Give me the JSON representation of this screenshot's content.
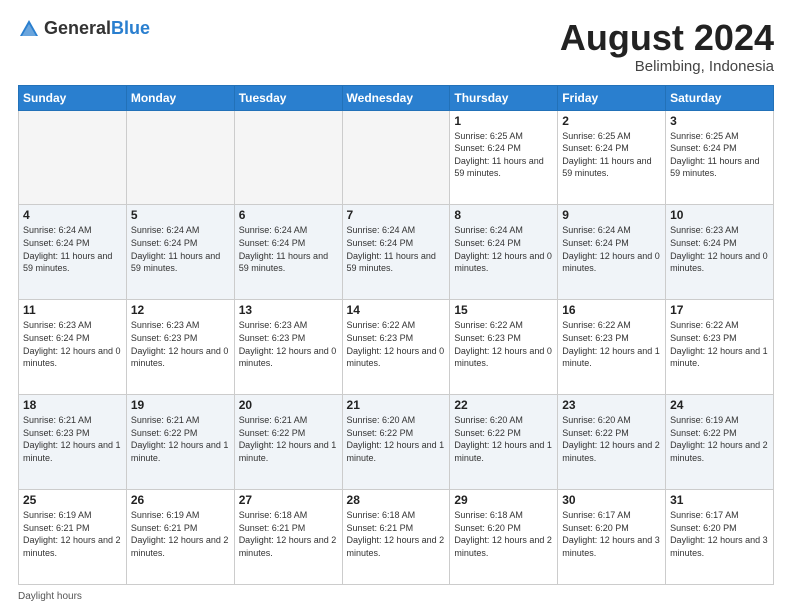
{
  "header": {
    "logo_general": "General",
    "logo_blue": "Blue",
    "title": "August 2024",
    "location": "Belimbing, Indonesia"
  },
  "days_of_week": [
    "Sunday",
    "Monday",
    "Tuesday",
    "Wednesday",
    "Thursday",
    "Friday",
    "Saturday"
  ],
  "footer": {
    "daylight_label": "Daylight hours"
  },
  "weeks": [
    [
      {
        "day": "",
        "empty": true
      },
      {
        "day": "",
        "empty": true
      },
      {
        "day": "",
        "empty": true
      },
      {
        "day": "",
        "empty": true
      },
      {
        "day": "1",
        "sunrise": "6:25 AM",
        "sunset": "6:24 PM",
        "daylight": "11 hours and 59 minutes."
      },
      {
        "day": "2",
        "sunrise": "6:25 AM",
        "sunset": "6:24 PM",
        "daylight": "11 hours and 59 minutes."
      },
      {
        "day": "3",
        "sunrise": "6:25 AM",
        "sunset": "6:24 PM",
        "daylight": "11 hours and 59 minutes."
      }
    ],
    [
      {
        "day": "4",
        "sunrise": "6:24 AM",
        "sunset": "6:24 PM",
        "daylight": "11 hours and 59 minutes."
      },
      {
        "day": "5",
        "sunrise": "6:24 AM",
        "sunset": "6:24 PM",
        "daylight": "11 hours and 59 minutes."
      },
      {
        "day": "6",
        "sunrise": "6:24 AM",
        "sunset": "6:24 PM",
        "daylight": "11 hours and 59 minutes."
      },
      {
        "day": "7",
        "sunrise": "6:24 AM",
        "sunset": "6:24 PM",
        "daylight": "11 hours and 59 minutes."
      },
      {
        "day": "8",
        "sunrise": "6:24 AM",
        "sunset": "6:24 PM",
        "daylight": "12 hours and 0 minutes."
      },
      {
        "day": "9",
        "sunrise": "6:24 AM",
        "sunset": "6:24 PM",
        "daylight": "12 hours and 0 minutes."
      },
      {
        "day": "10",
        "sunrise": "6:23 AM",
        "sunset": "6:24 PM",
        "daylight": "12 hours and 0 minutes."
      }
    ],
    [
      {
        "day": "11",
        "sunrise": "6:23 AM",
        "sunset": "6:24 PM",
        "daylight": "12 hours and 0 minutes."
      },
      {
        "day": "12",
        "sunrise": "6:23 AM",
        "sunset": "6:23 PM",
        "daylight": "12 hours and 0 minutes."
      },
      {
        "day": "13",
        "sunrise": "6:23 AM",
        "sunset": "6:23 PM",
        "daylight": "12 hours and 0 minutes."
      },
      {
        "day": "14",
        "sunrise": "6:22 AM",
        "sunset": "6:23 PM",
        "daylight": "12 hours and 0 minutes."
      },
      {
        "day": "15",
        "sunrise": "6:22 AM",
        "sunset": "6:23 PM",
        "daylight": "12 hours and 0 minutes."
      },
      {
        "day": "16",
        "sunrise": "6:22 AM",
        "sunset": "6:23 PM",
        "daylight": "12 hours and 1 minute."
      },
      {
        "day": "17",
        "sunrise": "6:22 AM",
        "sunset": "6:23 PM",
        "daylight": "12 hours and 1 minute."
      }
    ],
    [
      {
        "day": "18",
        "sunrise": "6:21 AM",
        "sunset": "6:23 PM",
        "daylight": "12 hours and 1 minute."
      },
      {
        "day": "19",
        "sunrise": "6:21 AM",
        "sunset": "6:22 PM",
        "daylight": "12 hours and 1 minute."
      },
      {
        "day": "20",
        "sunrise": "6:21 AM",
        "sunset": "6:22 PM",
        "daylight": "12 hours and 1 minute."
      },
      {
        "day": "21",
        "sunrise": "6:20 AM",
        "sunset": "6:22 PM",
        "daylight": "12 hours and 1 minute."
      },
      {
        "day": "22",
        "sunrise": "6:20 AM",
        "sunset": "6:22 PM",
        "daylight": "12 hours and 1 minute."
      },
      {
        "day": "23",
        "sunrise": "6:20 AM",
        "sunset": "6:22 PM",
        "daylight": "12 hours and 2 minutes."
      },
      {
        "day": "24",
        "sunrise": "6:19 AM",
        "sunset": "6:22 PM",
        "daylight": "12 hours and 2 minutes."
      }
    ],
    [
      {
        "day": "25",
        "sunrise": "6:19 AM",
        "sunset": "6:21 PM",
        "daylight": "12 hours and 2 minutes."
      },
      {
        "day": "26",
        "sunrise": "6:19 AM",
        "sunset": "6:21 PM",
        "daylight": "12 hours and 2 minutes."
      },
      {
        "day": "27",
        "sunrise": "6:18 AM",
        "sunset": "6:21 PM",
        "daylight": "12 hours and 2 minutes."
      },
      {
        "day": "28",
        "sunrise": "6:18 AM",
        "sunset": "6:21 PM",
        "daylight": "12 hours and 2 minutes."
      },
      {
        "day": "29",
        "sunrise": "6:18 AM",
        "sunset": "6:20 PM",
        "daylight": "12 hours and 2 minutes."
      },
      {
        "day": "30",
        "sunrise": "6:17 AM",
        "sunset": "6:20 PM",
        "daylight": "12 hours and 3 minutes."
      },
      {
        "day": "31",
        "sunrise": "6:17 AM",
        "sunset": "6:20 PM",
        "daylight": "12 hours and 3 minutes."
      }
    ]
  ]
}
